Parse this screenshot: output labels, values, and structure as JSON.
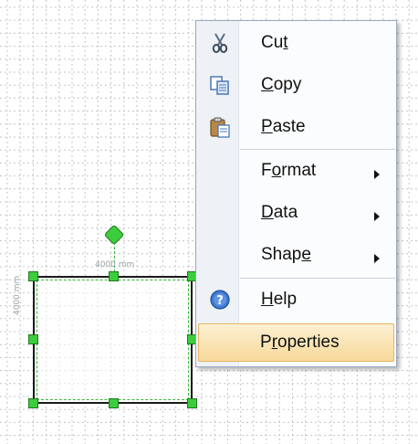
{
  "canvas": {
    "selected_shape": {
      "width_label": "4000 mm",
      "height_label": "4000 mm"
    }
  },
  "context_menu": {
    "items": [
      {
        "label": "Cut",
        "mnemonic_index": 2,
        "icon": "scissors-icon",
        "submenu": false
      },
      {
        "label": "Copy",
        "mnemonic_index": 0,
        "icon": "copy-icon",
        "submenu": false
      },
      {
        "label": "Paste",
        "mnemonic_index": 0,
        "icon": "paste-icon",
        "submenu": false
      },
      {
        "label": "Format",
        "mnemonic_index": 1,
        "icon": "",
        "submenu": true
      },
      {
        "label": "Data",
        "mnemonic_index": 0,
        "icon": "",
        "submenu": true
      },
      {
        "label": "Shape",
        "mnemonic_index": 4,
        "icon": "",
        "submenu": true
      },
      {
        "label": "Help",
        "mnemonic_index": 0,
        "icon": "help-icon",
        "submenu": false
      },
      {
        "label": "Properties",
        "mnemonic_index": 1,
        "icon": "",
        "submenu": false,
        "highlighted": true
      }
    ],
    "submenu_arrow": "▶",
    "highlight_color": "#f7d99a"
  }
}
